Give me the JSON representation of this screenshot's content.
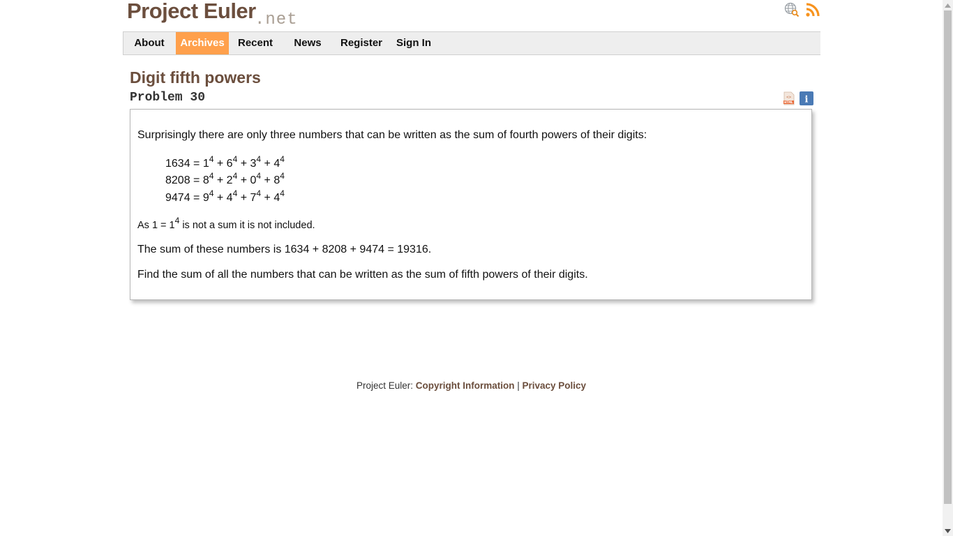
{
  "header": {
    "logo_main": "Project Euler",
    "logo_net": ".net",
    "icons": [
      "globe-search-icon",
      "rss-icon"
    ]
  },
  "nav": {
    "items": [
      {
        "label": "About",
        "active": false
      },
      {
        "label": "Archives",
        "active": true
      },
      {
        "label": "Recent",
        "active": false
      },
      {
        "label": "News",
        "active": false
      },
      {
        "label": "Register",
        "active": false
      },
      {
        "label": "Sign In",
        "active": false
      }
    ],
    "active_color": "#ffa04c"
  },
  "problem": {
    "title": "Digit fifth powers",
    "number_label": "Problem 30",
    "tool_icons": [
      "html-file-icon",
      "info-icon"
    ],
    "intro": "Surprisingly there are only three numbers that can be written as the sum of fourth powers of their digits:",
    "equations": [
      {
        "lhs": "1634",
        "digits": [
          "1",
          "6",
          "3",
          "4"
        ],
        "power": "4"
      },
      {
        "lhs": "8208",
        "digits": [
          "8",
          "2",
          "0",
          "8"
        ],
        "power": "4"
      },
      {
        "lhs": "9474",
        "digits": [
          "9",
          "4",
          "7",
          "4"
        ],
        "power": "4"
      }
    ],
    "note_pre": "As 1 = 1",
    "note_power": "4",
    "note_post": " is not a sum it is not included.",
    "sum_text": "The sum of these numbers is 1634 + 8208 + 9474 = 19316.",
    "task": "Find the sum of all the numbers that can be written as the sum of fifth powers of their digits."
  },
  "footer": {
    "prefix": "Project Euler: ",
    "copyright_link": "Copyright Information",
    "separator": " | ",
    "privacy_link": "Privacy Policy"
  },
  "colors": {
    "brand_brown": "#6b4e3d",
    "nav_bg": "#eeeeee",
    "accent_orange": "#ffa04c"
  }
}
